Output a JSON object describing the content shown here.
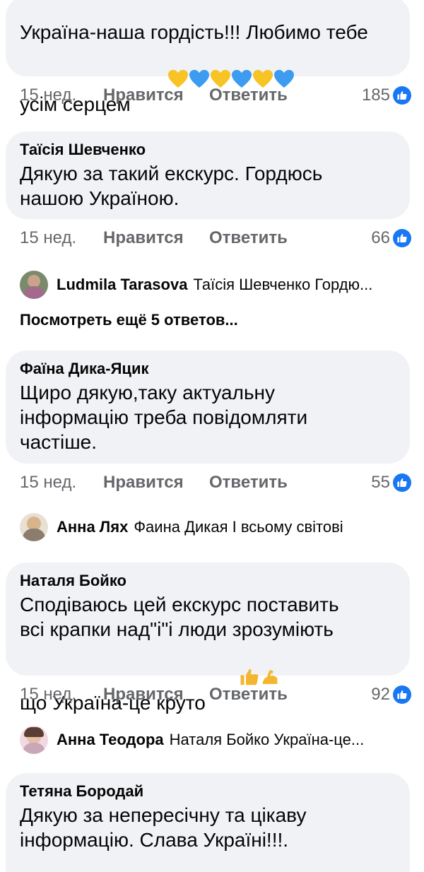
{
  "comments": [
    {
      "author": "",
      "text": "Україна-наша гордість!!! Любимо тебе\nусім серцем",
      "time": "15 нед.",
      "like": "Нравится",
      "reply": "Ответить",
      "likes": "185"
    },
    {
      "author": "Таїсія Шевченко",
      "text": "Дякую за такий екскурс. Гордюсь\nнашою Україною.",
      "time": "15 нед.",
      "like": "Нравится",
      "reply": "Ответить",
      "likes": "66"
    },
    {
      "author": "Фаїна Дика-Яцик",
      "text": "Щиро дякую,таку актуальну\nінформацію треба повідомляти\nчастіше.",
      "time": "15 нед.",
      "like": "Нравится",
      "reply": "Ответить",
      "likes": "55"
    },
    {
      "author": "Наталя Бойко",
      "text": "Сподіваюсь цей екскурс поставить\nвсі крапки над\"і\"і люди зрозуміють\nщо Україна-це круто",
      "time": "15 нед.",
      "like": "Нравится",
      "reply": "Ответить",
      "likes": "92"
    },
    {
      "author": "Тетяна Бородай",
      "text": "Дякую за непересічну та цікаву\nінформацію. Слава Україні!!!.",
      "time": "",
      "like": "",
      "reply": "",
      "likes": ""
    }
  ],
  "replies": [
    {
      "author": "Ludmila Tarasova",
      "text": "Таїсія Шевченко Гордю..."
    },
    {
      "author": "Анна Лях",
      "text": "Фаина Дикая І всьому світові"
    },
    {
      "author": "Анна Теодора",
      "text": "Наталя Бойко Україна-це..."
    }
  ],
  "more_replies": "Посмотреть ещё 5 ответов...",
  "colors": {
    "bubble": "#f0f2f5",
    "meta": "#65676b",
    "like_blue": "#1877f2",
    "heart_yellow": "#f7c325",
    "heart_blue": "#3d9bf0"
  },
  "icons": [
    "yellow-heart-icon",
    "blue-heart-icon",
    "thumbs-up-icon",
    "flexed-biceps-icon",
    "like-reaction-icon"
  ]
}
